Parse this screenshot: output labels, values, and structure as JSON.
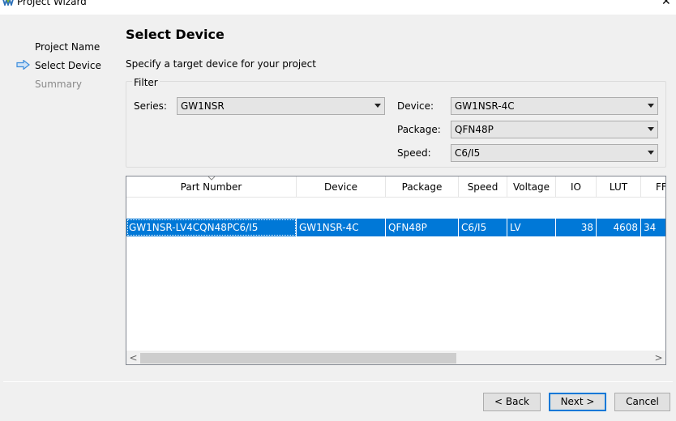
{
  "window": {
    "title": "Project Wizard",
    "close_glyph": "✕"
  },
  "steps": [
    {
      "label": "Project Name",
      "state": "done"
    },
    {
      "label": "Select Device",
      "state": "current"
    },
    {
      "label": "Summary",
      "state": "pending"
    }
  ],
  "page": {
    "title": "Select Device",
    "description": "Specify a target device for your project"
  },
  "filter": {
    "group_label": "Filter",
    "series": {
      "label": "Series:",
      "value": "GW1NSR"
    },
    "device": {
      "label": "Device:",
      "value": "GW1NSR-4C"
    },
    "package": {
      "label": "Package:",
      "value": "QFN48P"
    },
    "speed": {
      "label": "Speed:",
      "value": "C6/I5"
    }
  },
  "table": {
    "columns": [
      "Part Number",
      "Device",
      "Package",
      "Speed",
      "Voltage",
      "IO",
      "LUT",
      "FF"
    ],
    "rows": [
      {
        "part_number": "GW1NSR-LV4CQN48PC6/I5",
        "device": "GW1NSR-4C",
        "package": "QFN48P",
        "speed": "C6/I5",
        "voltage": "LV",
        "io": "38",
        "lut": "4608",
        "ff": "34"
      }
    ],
    "selected_row": 0,
    "scroll_left_glyph": "<",
    "scroll_right_glyph": ">"
  },
  "buttons": {
    "back": "< Back",
    "next": "Next >",
    "cancel": "Cancel"
  },
  "colors": {
    "selection": "#0078d7",
    "nav_arrow": "#3c8ddc",
    "muted_text": "#8a8a8a"
  },
  "icons": {
    "logo": "gowin-logo-icon",
    "nav_arrow": "arrow-right-icon",
    "sort": "sort-indicator-icon"
  }
}
